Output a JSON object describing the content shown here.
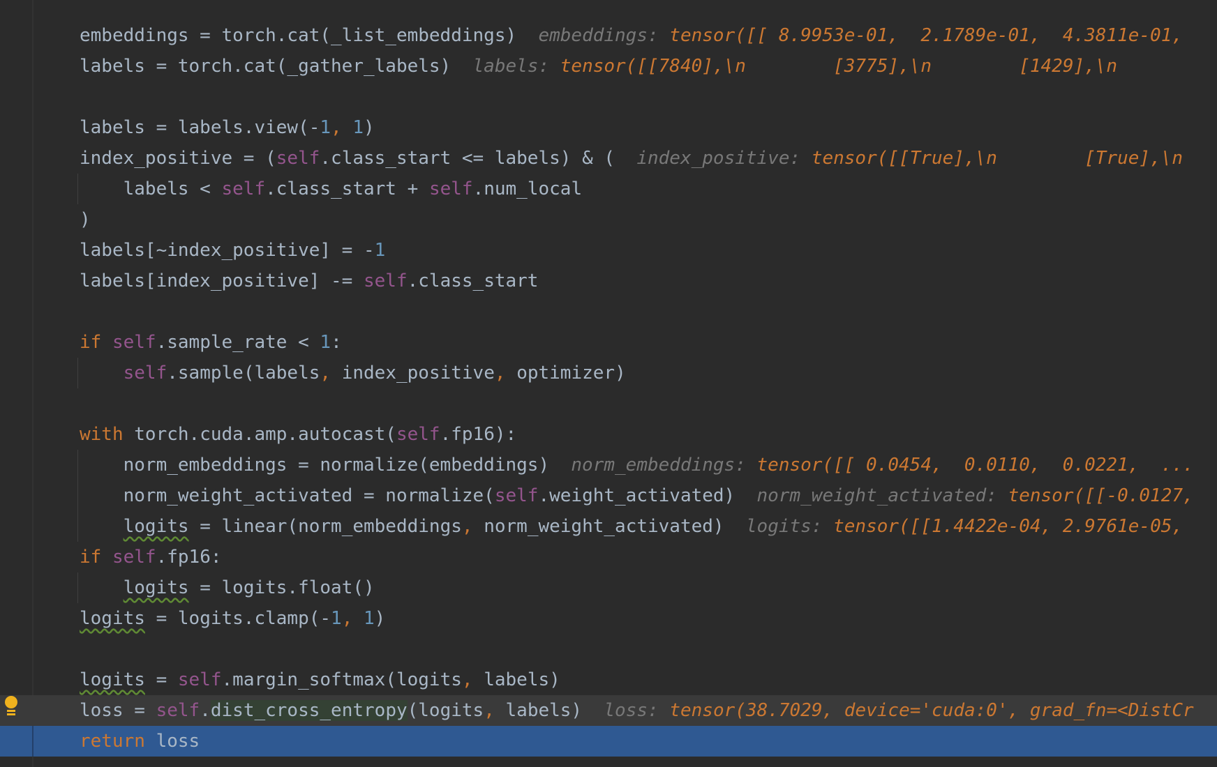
{
  "editor": {
    "lines": [
      {
        "segments": [
          {
            "t": "embeddings = torch.cat(_list_embeddings)"
          }
        ],
        "hint": {
          "label": "embeddings:",
          "value": "tensor([[ 8.9953e-01,  2.1789e-01,  4.3811e-01,"
        }
      },
      {
        "segments": [
          {
            "t": "labels = torch.cat(_gather_labels)"
          }
        ],
        "hint": {
          "label": "labels:",
          "value": "tensor([[7840],\\n        [3775],\\n        [1429],\\n"
        }
      },
      {
        "segments": []
      },
      {
        "segments": [
          {
            "t": "labels = labels.view(-"
          },
          {
            "t": "1",
            "c": "num"
          },
          {
            "t": ", ",
            "c": "punc"
          },
          {
            "t": "1",
            "c": "num"
          },
          {
            "t": ")"
          }
        ]
      },
      {
        "segments": [
          {
            "t": "index_positive = ("
          },
          {
            "t": "self",
            "c": "self"
          },
          {
            "t": ".class_start <= labels) & ("
          }
        ],
        "hint": {
          "label": "index_positive:",
          "value": "tensor([[True],\\n        [True],\\n"
        }
      },
      {
        "segments": [
          {
            "t": "    labels < "
          },
          {
            "t": "self",
            "c": "self"
          },
          {
            "t": ".class_start + "
          },
          {
            "t": "self",
            "c": "self"
          },
          {
            "t": ".num_local"
          }
        ]
      },
      {
        "segments": [
          {
            "t": ")"
          }
        ]
      },
      {
        "segments": [
          {
            "t": "labels[~index_positive] = -"
          },
          {
            "t": "1",
            "c": "num"
          }
        ]
      },
      {
        "segments": [
          {
            "t": "labels[index_positive] -= "
          },
          {
            "t": "self",
            "c": "self"
          },
          {
            "t": ".class_start"
          }
        ]
      },
      {
        "segments": []
      },
      {
        "segments": [
          {
            "t": "if ",
            "c": "kw"
          },
          {
            "t": "self",
            "c": "self"
          },
          {
            "t": ".sample_rate < "
          },
          {
            "t": "1",
            "c": "num"
          },
          {
            "t": ":"
          }
        ]
      },
      {
        "segments": [
          {
            "t": "    "
          },
          {
            "t": "self",
            "c": "self"
          },
          {
            "t": ".sample(labels"
          },
          {
            "t": ", ",
            "c": "punc"
          },
          {
            "t": "index_positive"
          },
          {
            "t": ", ",
            "c": "punc"
          },
          {
            "t": "optimizer)"
          }
        ]
      },
      {
        "segments": []
      },
      {
        "segments": [
          {
            "t": "with ",
            "c": "kw"
          },
          {
            "t": "torch.cuda.amp.autocast("
          },
          {
            "t": "self",
            "c": "self"
          },
          {
            "t": ".fp16):"
          }
        ]
      },
      {
        "segments": [
          {
            "t": "    norm_embeddings = normalize(embeddings)"
          }
        ],
        "hint": {
          "label": "norm_embeddings:",
          "value": "tensor([[ 0.0454,  0.0110,  0.0221,  ..."
        }
      },
      {
        "segments": [
          {
            "t": "    norm_weight_activated = normalize("
          },
          {
            "t": "self",
            "c": "self"
          },
          {
            "t": ".weight_activated)"
          }
        ],
        "hint": {
          "label": "norm_weight_activated:",
          "value": "tensor([[-0.0127,"
        }
      },
      {
        "segments": [
          {
            "t": "    "
          },
          {
            "t": "logits",
            "c": "warn"
          },
          {
            "t": " = linear(norm_embeddings"
          },
          {
            "t": ", ",
            "c": "punc"
          },
          {
            "t": "norm_weight_activated)"
          }
        ],
        "hint": {
          "label": "logits:",
          "value": "tensor([[1.4422e-04, 2.9761e-05,"
        }
      },
      {
        "segments": [
          {
            "t": "if ",
            "c": "kw"
          },
          {
            "t": "self",
            "c": "self"
          },
          {
            "t": ".fp16:"
          }
        ]
      },
      {
        "segments": [
          {
            "t": "    "
          },
          {
            "t": "logits",
            "c": "warn"
          },
          {
            "t": " = logits.float()"
          }
        ]
      },
      {
        "segments": [
          {
            "t": "logits",
            "c": "warn"
          },
          {
            "t": " = logits.clamp(-"
          },
          {
            "t": "1",
            "c": "num"
          },
          {
            "t": ", ",
            "c": "punc"
          },
          {
            "t": "1",
            "c": "num"
          },
          {
            "t": ")"
          }
        ]
      },
      {
        "segments": []
      },
      {
        "segments": [
          {
            "t": "logits",
            "c": "warn"
          },
          {
            "t": " = "
          },
          {
            "t": "self",
            "c": "self"
          },
          {
            "t": ".margin_softmax(logits"
          },
          {
            "t": ", ",
            "c": "punc"
          },
          {
            "t": "labels)"
          }
        ]
      },
      {
        "segments": [
          {
            "t": "loss = "
          },
          {
            "t": "self",
            "c": "self"
          },
          {
            "t": "."
          },
          {
            "t": "dist_cross_entropy",
            "c": "hl"
          },
          {
            "t": "(logits"
          },
          {
            "t": ", ",
            "c": "punc"
          },
          {
            "t": "labels)"
          }
        ],
        "hint": {
          "label": "loss:",
          "value": "tensor(38.7029, device='cuda:0', grad_fn=<DistCr"
        },
        "state": "current"
      },
      {
        "segments": [
          {
            "t": "return ",
            "c": "kw"
          },
          {
            "t": "loss"
          }
        ],
        "state": "exec"
      }
    ]
  },
  "icons": {
    "intention": "lightbulb-icon"
  },
  "colors": {
    "background": "#2b2b2b",
    "keyword": "#cc7832",
    "self": "#94558d",
    "number": "#6897bb",
    "inlay_label": "#787878",
    "inlay_value": "#cc7832",
    "execution_line": "#2f5992"
  }
}
